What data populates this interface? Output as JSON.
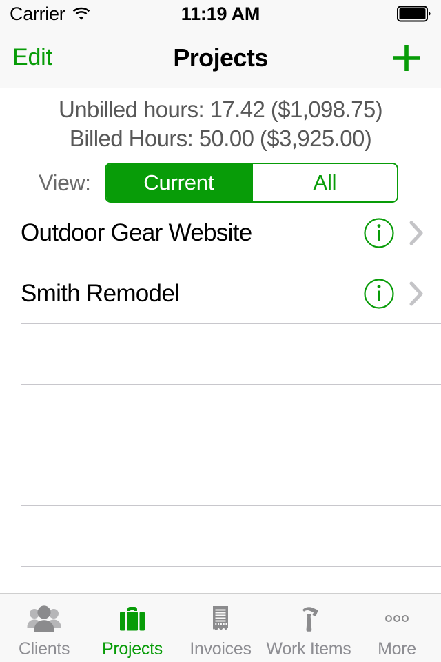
{
  "colors": {
    "accent_green": "#089c08",
    "inactive_gray": "#8e8e93",
    "bar_background": "#f8f8f8",
    "separator": "#c8c7cc",
    "summary_text": "#585858"
  },
  "status_bar": {
    "carrier": "Carrier",
    "wifi_icon": "wifi-icon",
    "time": "11:19 AM",
    "battery_icon": "battery-full-icon"
  },
  "nav_bar": {
    "edit_label": "Edit",
    "title": "Projects",
    "add_icon": "plus-icon"
  },
  "header": {
    "unbilled_line": "Unbilled hours: 17.42 ($1,098.75)",
    "billed_line": "Billed Hours: 50.00 ($3,925.00)",
    "view_label": "View:",
    "segments": [
      {
        "label": "Current",
        "selected": true
      },
      {
        "label": "All",
        "selected": false
      }
    ]
  },
  "list": {
    "rows": [
      {
        "title": "Outdoor Gear Website",
        "info_icon": "info-circle-icon",
        "disclosure_icon": "chevron-right-icon"
      },
      {
        "title": "Smith Remodel",
        "info_icon": "info-circle-icon",
        "disclosure_icon": "chevron-right-icon"
      }
    ],
    "empty_row_count": 5
  },
  "tab_bar": {
    "items": [
      {
        "label": "Clients",
        "icon": "people-group-icon",
        "active": false
      },
      {
        "label": "Projects",
        "icon": "briefcase-icon",
        "active": true
      },
      {
        "label": "Invoices",
        "icon": "receipt-icon",
        "active": false
      },
      {
        "label": "Work Items",
        "icon": "hammer-icon",
        "active": false
      },
      {
        "label": "More",
        "icon": "ellipsis-icon",
        "active": false
      }
    ]
  }
}
